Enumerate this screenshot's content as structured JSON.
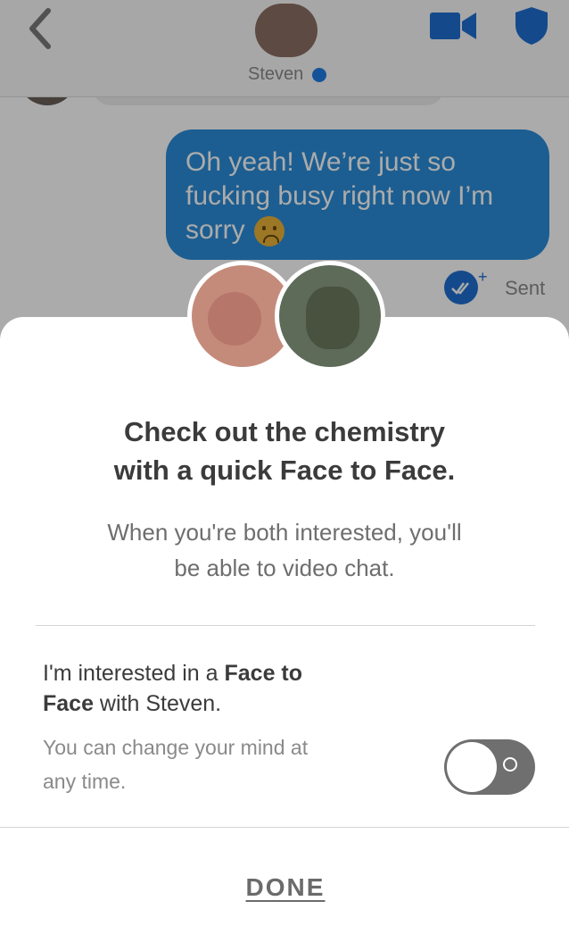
{
  "header": {
    "name": "Steven",
    "back_icon": "chevron-left-icon",
    "video_icon": "video-camera-icon",
    "safety_icon": "shield-icon"
  },
  "chat": {
    "message_text": "Oh yeah! We’re just so fucking busy right now I’m sorry",
    "emoji": "frowning-face-emoji",
    "status": "Sent",
    "bubble_color": "#2b8cd9"
  },
  "sheet": {
    "title_line1": "Check out the chemistry",
    "title_line2": "with a quick Face to Face.",
    "subtitle_line1": "When you're both interested, you'll",
    "subtitle_line2": "be able to video chat.",
    "pref_prefix": "I'm interested in a ",
    "pref_bold1": "Face to",
    "pref_bold2": "Face",
    "pref_suffix": " with Steven.",
    "note_line1": "You can change your mind at",
    "note_line2": "any time.",
    "toggle_on": false,
    "done_label": "DONE"
  }
}
